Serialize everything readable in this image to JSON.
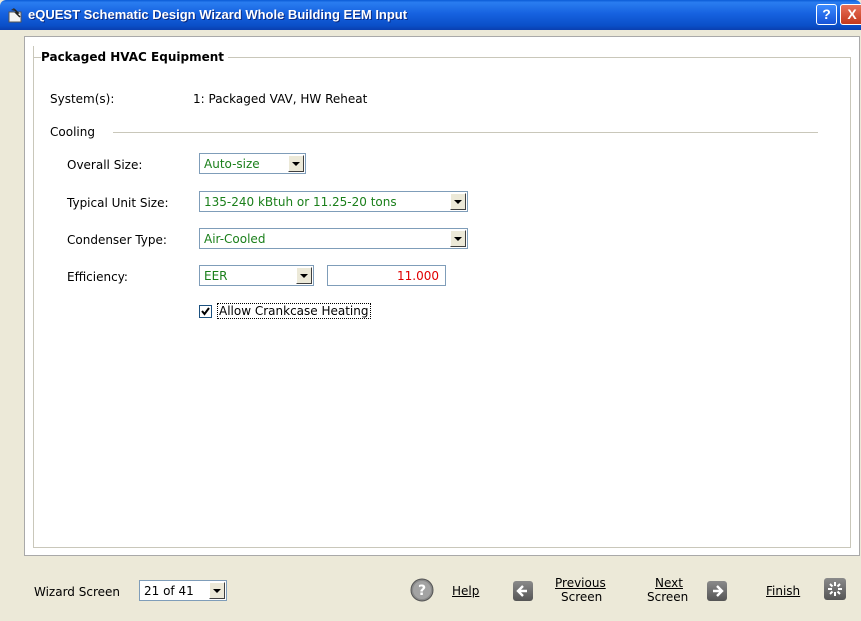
{
  "window": {
    "title": "eQUEST Schematic Design Wizard Whole Building EEM Input",
    "help_glyph": "?",
    "close_glyph": "X"
  },
  "section": {
    "title": "Packaged HVAC Equipment",
    "systems_label": "System(s):",
    "systems_value": "1: Packaged VAV, HW Reheat"
  },
  "cooling": {
    "title": "Cooling",
    "overall_size": {
      "label": "Overall Size:",
      "value": "Auto-size"
    },
    "typical_unit_size": {
      "label": "Typical Unit Size:",
      "value": "135-240 kBtuh or 11.25-20 tons"
    },
    "condenser_type": {
      "label": "Condenser Type:",
      "value": "Air-Cooled"
    },
    "efficiency": {
      "label": "Efficiency:",
      "type_value": "EER",
      "value": "11.000"
    },
    "crankcase": {
      "label": "Allow Crankcase Heating",
      "checked": true
    }
  },
  "footer": {
    "wizard_screen_label": "Wizard Screen",
    "wizard_screen_value": "21 of 41",
    "help_label": "Help",
    "previous_line1": "Previous",
    "previous_line2": "Screen",
    "next_line1": "Next",
    "next_line2": "Screen",
    "finish_label": "Finish"
  },
  "colors": {
    "field_value": "#1a7f1a",
    "numeric_value": "#e00000",
    "title_bar": "#0a4fc8"
  },
  "icons": [
    "app-icon",
    "help-icon",
    "close-icon",
    "chevron-down-icon",
    "checkmark-icon",
    "question-icon",
    "arrow-left-icon",
    "arrow-right-icon",
    "finish-icon"
  ]
}
